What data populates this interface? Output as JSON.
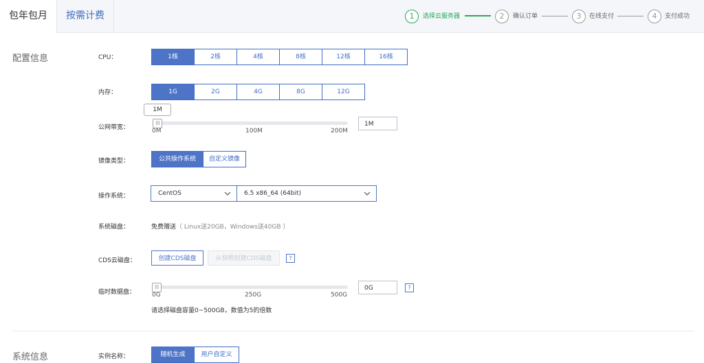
{
  "tabs": [
    {
      "label": "包年包月"
    },
    {
      "label": "按需计费"
    }
  ],
  "steps": [
    {
      "num": "1",
      "label": "选择云服务器"
    },
    {
      "num": "2",
      "label": "确认订单"
    },
    {
      "num": "3",
      "label": "在线支付"
    },
    {
      "num": "4",
      "label": "支付成功"
    }
  ],
  "sections": {
    "config": "配置信息",
    "system": "系统信息"
  },
  "cpu": {
    "label": "CPU：",
    "options": [
      "1核",
      "2核",
      "4核",
      "8核",
      "12核",
      "16核"
    ],
    "selected": "1核"
  },
  "memory": {
    "label": "内存：",
    "options": [
      "1G",
      "2G",
      "4G",
      "8G",
      "12G"
    ],
    "selected": "1G"
  },
  "bandwidth": {
    "label": "公网带宽：",
    "tooltip": "1M",
    "ticks": [
      "0M",
      "100M",
      "200M"
    ],
    "value": "1M",
    "level": 0.005
  },
  "image_type": {
    "label": "镜像类型：",
    "options": [
      "公共操作系统",
      "自定义镜像"
    ],
    "selected": "公共操作系统"
  },
  "os": {
    "label": "操作系统：",
    "distro": "CentOS",
    "version": "6.5 x86_64 (64bit)"
  },
  "system_disk": {
    "label": "系统磁盘：",
    "text": "免费赠送",
    "note": "（ Linux送20GB，Windows送40GB ）"
  },
  "cds": {
    "label": "CDS云磁盘：",
    "create_btn": "创建CDS磁盘",
    "snapshot_btn": "从快照创建CDS磁盘",
    "help": "?"
  },
  "temp_disk": {
    "label": "临时数据盘：",
    "ticks": [
      "0G",
      "250G",
      "500G"
    ],
    "value": "0G",
    "level": 0,
    "help": "?",
    "hint": "请选择磁盘容量0~500GB，数值为5的倍数"
  },
  "instance_name": {
    "label": "实例名称：",
    "options": [
      "随机生成",
      "用户自定义"
    ],
    "selected": "随机生成"
  },
  "colors": {
    "accent": "#4d74c6",
    "step_active": "#27a856"
  }
}
